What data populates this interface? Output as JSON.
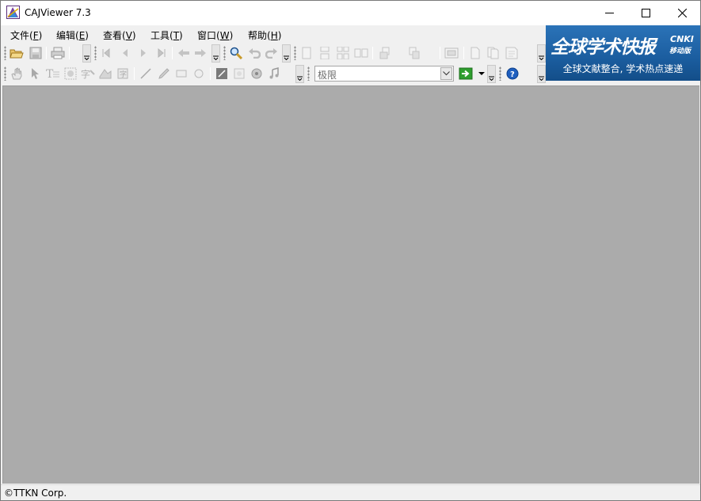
{
  "window": {
    "title": "CAJViewer 7.3"
  },
  "menu": [
    {
      "label": "文件(",
      "key": "F",
      "suffix": ")"
    },
    {
      "label": "编辑(",
      "key": "E",
      "suffix": ")"
    },
    {
      "label": "查看(",
      "key": "V",
      "suffix": ")"
    },
    {
      "label": "工具(",
      "key": "T",
      "suffix": ")"
    },
    {
      "label": "窗口(",
      "key": "W",
      "suffix": ")"
    },
    {
      "label": "帮助(",
      "key": "H",
      "suffix": ")"
    }
  ],
  "toolbar": {
    "zoom_value": "极限",
    "icons_row1": [
      "open-folder-icon",
      "save-icon",
      "print-icon",
      "first-page-icon",
      "prev-page-icon",
      "next-page-icon",
      "last-page-icon",
      "back-icon",
      "forward-icon",
      "search-icon",
      "undo-icon",
      "redo-icon",
      "single-page-icon",
      "continuous-icon",
      "facing-icon",
      "two-page-icon",
      "rotate-icon",
      "layout-icon",
      "fullscreen-icon",
      "page-icon",
      "copy-page-icon",
      "note-page-icon"
    ],
    "icons_row2": [
      "hand-tool-icon",
      "select-arrow-icon",
      "text-select-icon",
      "image-select-icon",
      "ocr-icon",
      "snapshot-icon",
      "export-icon",
      "line-icon",
      "pencil-icon",
      "rectangle-icon",
      "ellipse-icon",
      "highlight-icon",
      "stamp-icon",
      "media-icon",
      "music-icon",
      "go-icon",
      "help-icon"
    ]
  },
  "banner": {
    "headline": "全球学术快报",
    "brand": "CNKI",
    "tag": "移动版",
    "subtitle": "全球文献整合, 学术热点速递"
  },
  "status": {
    "text": "©TTKN Corp."
  },
  "colors": {
    "workspace": "#ababab",
    "banner": "#1b5d9f",
    "go_button": "#2e9e2e",
    "help": "#1f5fbf"
  }
}
